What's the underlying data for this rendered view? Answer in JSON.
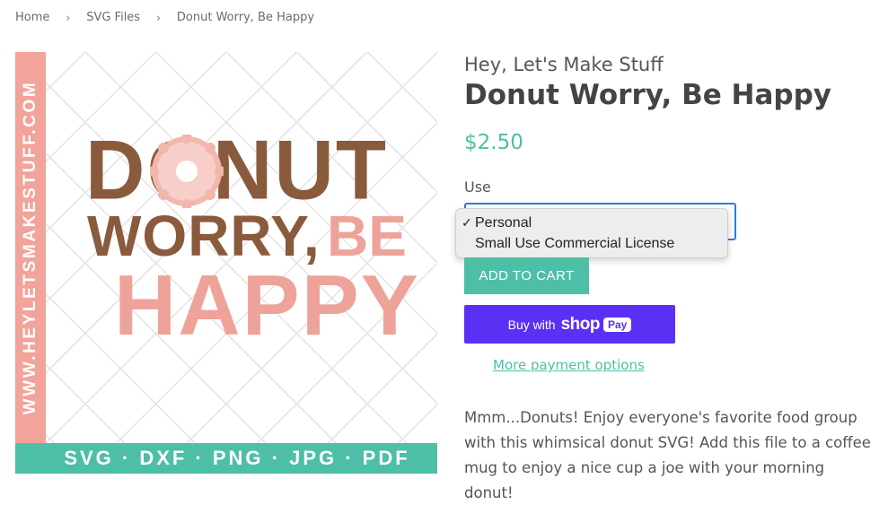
{
  "breadcrumb": {
    "items": [
      "Home",
      "SVG Files",
      "Donut Worry, Be Happy"
    ],
    "separator": "›"
  },
  "product_image": {
    "side_text": "WWW.HEYLETSMAKESTUFF.COM",
    "bottom_text": "SVG · DXF · PNG · JPG · PDF",
    "art_words": [
      "DONUT",
      "WORRY,",
      "BE",
      "HAPPY"
    ]
  },
  "product": {
    "vendor": "Hey, Let's Make Stuff",
    "title": "Donut Worry, Be Happy",
    "price": "$2.50",
    "option_label": "Use",
    "options": [
      "Personal",
      "Small Use Commercial License"
    ],
    "selected_option": "Personal",
    "add_to_cart": "ADD TO CART",
    "shop_pay_prefix": "Buy with",
    "shop_pay_brand": "shop",
    "shop_pay_pill": "Pay",
    "more_payment": "More payment options",
    "description": "Mmm...Donuts! Enjoy everyone's favorite food group with this whimsical donut SVG! Add this file to a coffee mug to enjoy a nice cup a joe with your morning donut!"
  },
  "colors": {
    "accent": "#4dbfa6",
    "shop_pay": "#5a31f4",
    "brown": "#8a5a3c",
    "pink": "#eea39a"
  }
}
